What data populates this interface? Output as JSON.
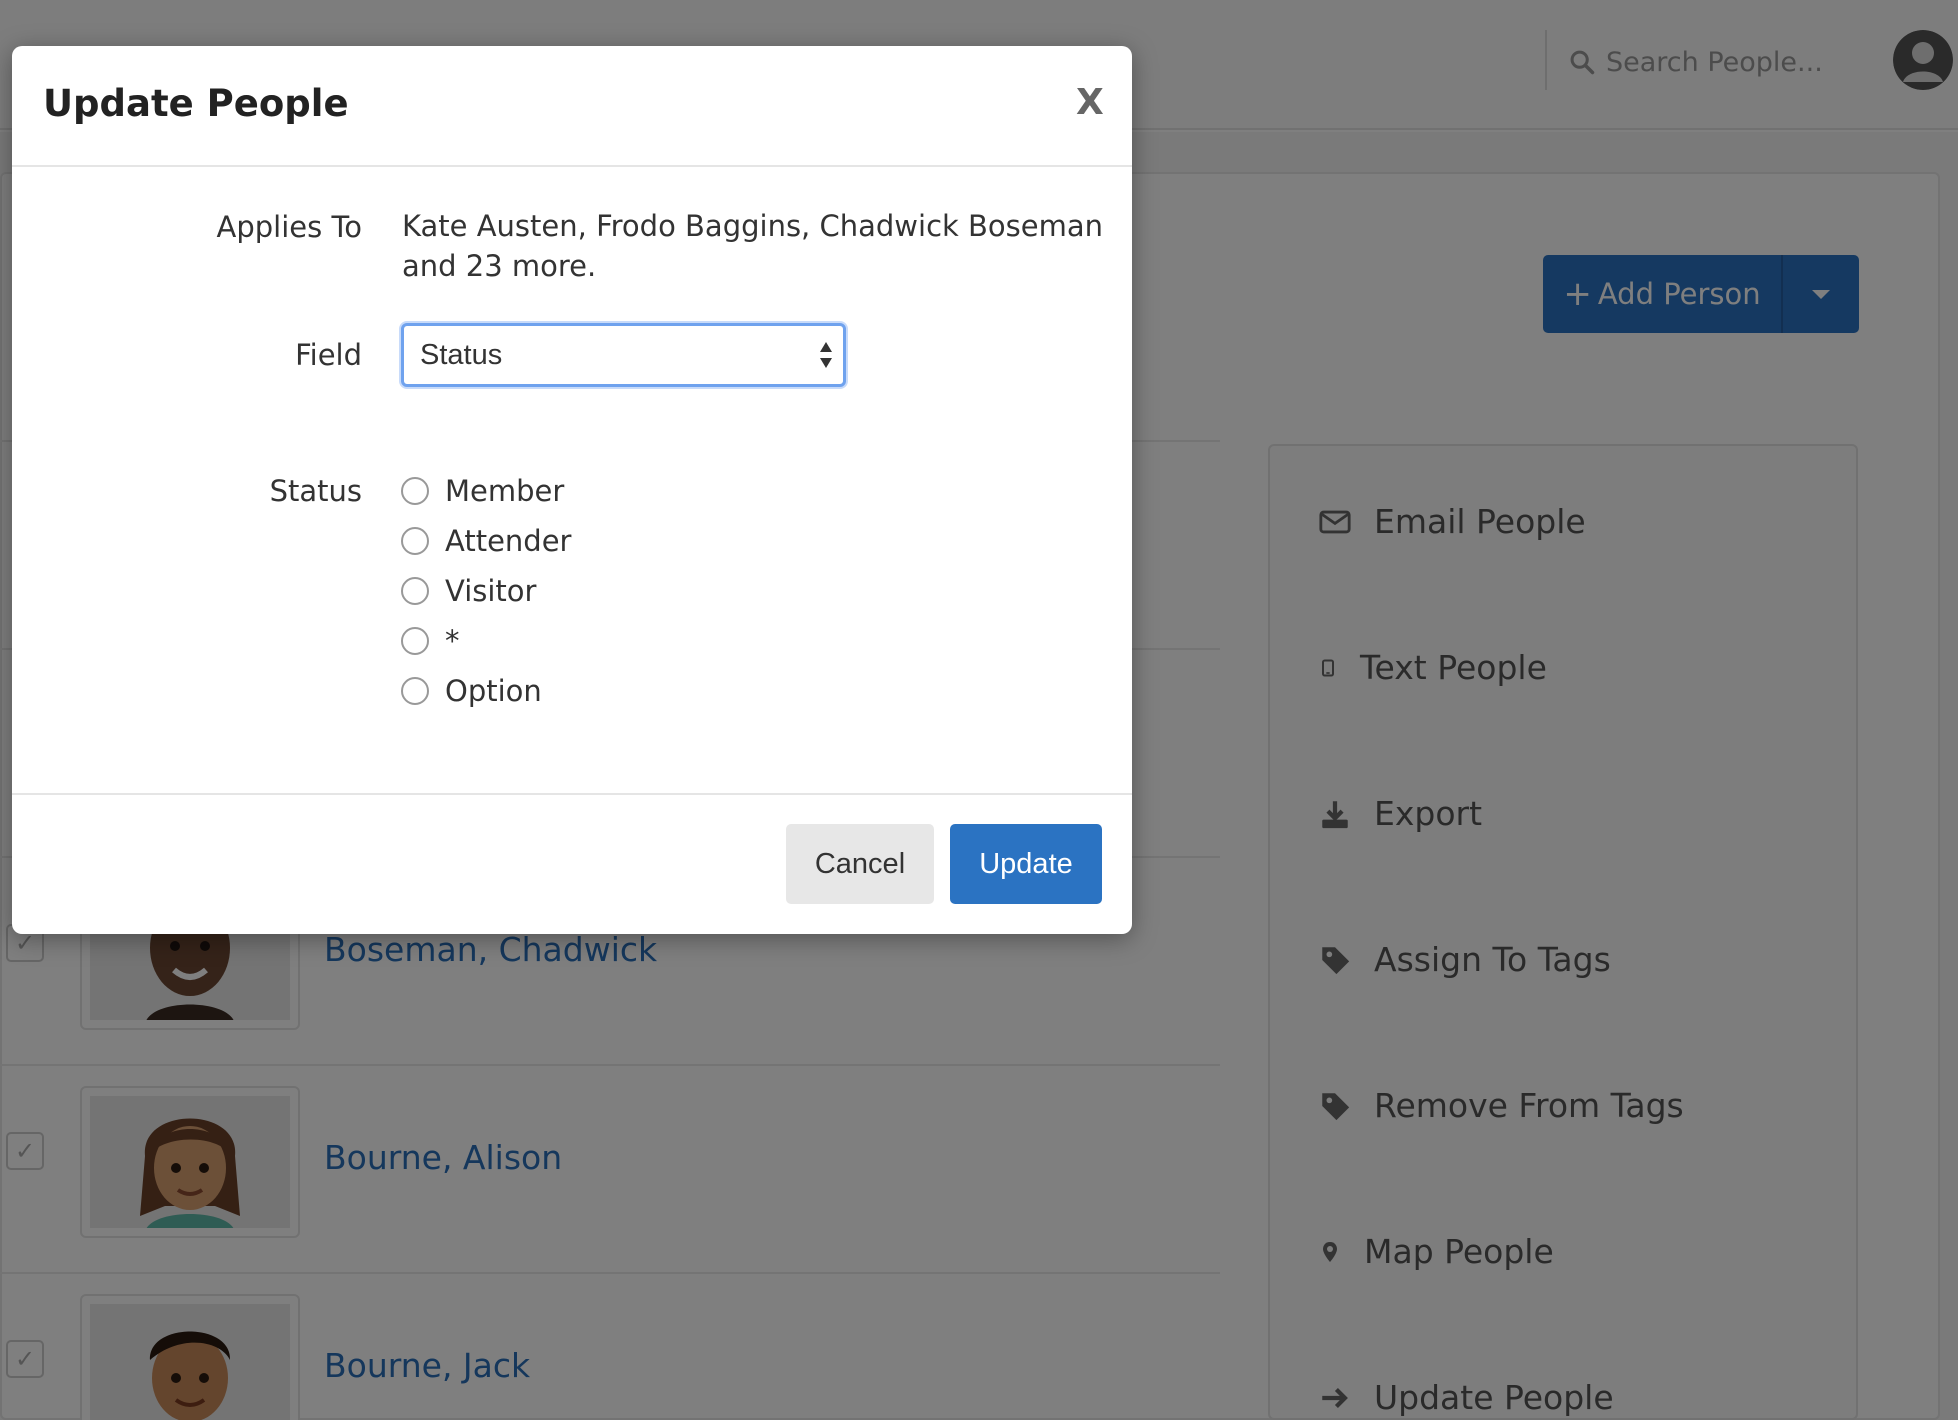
{
  "header": {
    "search_placeholder": "Search People..."
  },
  "toolbar": {
    "add_person_label": "Add Person"
  },
  "people": [
    {
      "name": "Boseman, Chadwick"
    },
    {
      "name": "Bourne, Alison"
    },
    {
      "name": "Bourne, Jack"
    }
  ],
  "actions": [
    {
      "label": "Email People",
      "icon": "envelope-icon"
    },
    {
      "label": "Text People",
      "icon": "mobile-icon"
    },
    {
      "label": "Export",
      "icon": "download-icon"
    },
    {
      "label": "Assign To Tags",
      "icon": "tag-icon"
    },
    {
      "label": "Remove From Tags",
      "icon": "tag-icon"
    },
    {
      "label": "Map People",
      "icon": "map-marker-icon"
    },
    {
      "label": "Update People",
      "icon": "arrow-right-icon"
    }
  ],
  "modal": {
    "title": "Update People",
    "close_label": "X",
    "applies_to_label": "Applies To",
    "applies_to_line1": "Kate Austen, Frodo Baggins, Chadwick Boseman",
    "applies_to_line2": "and 23 more.",
    "field_label": "Field",
    "field_value": "Status",
    "status_label": "Status",
    "status_options": [
      "Member",
      "Attender",
      "Visitor",
      "*",
      "Option"
    ],
    "cancel_label": "Cancel",
    "update_label": "Update"
  },
  "colors": {
    "primary": "#2b73c2",
    "link": "#2a6fb8",
    "focus_ring": "#6fa2ee"
  }
}
